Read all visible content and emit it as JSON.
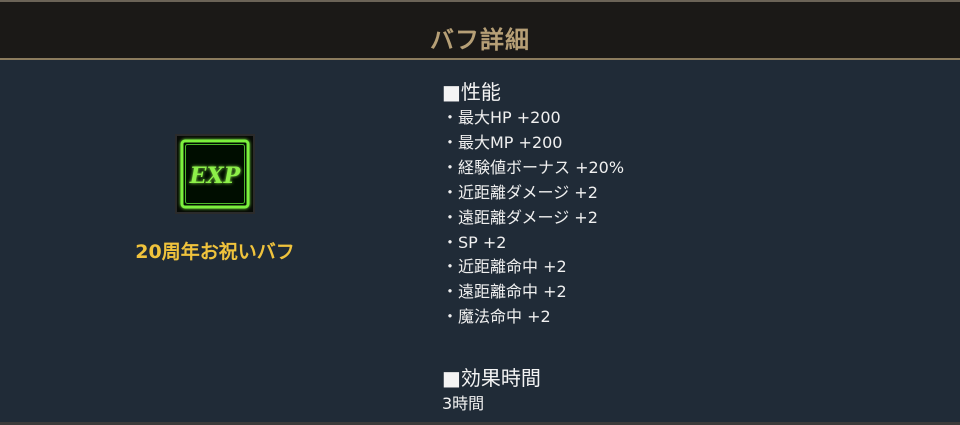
{
  "header": {
    "title": "バフ詳細"
  },
  "buff": {
    "icon": "exp-icon",
    "icon_text": "EXP",
    "name": "20周年お祝いバフ"
  },
  "performance": {
    "heading": "■性能",
    "stats": [
      "・最大HP +200",
      "・最大MP +200",
      "・経験値ボーナス +20%",
      "・近距離ダメージ +2",
      "・遠距離ダメージ +2",
      "・SP +2",
      "・近距離命中 +2",
      "・遠距離命中 +2",
      "・魔法命中 +2"
    ]
  },
  "duration": {
    "heading": "■効果時間",
    "value": "3時間"
  },
  "colors": {
    "background": "#202b37",
    "header_background": "#1b1917",
    "header_title": "#b69f76",
    "buff_name": "#f0c33c",
    "icon_glow": "#7cf03c"
  }
}
